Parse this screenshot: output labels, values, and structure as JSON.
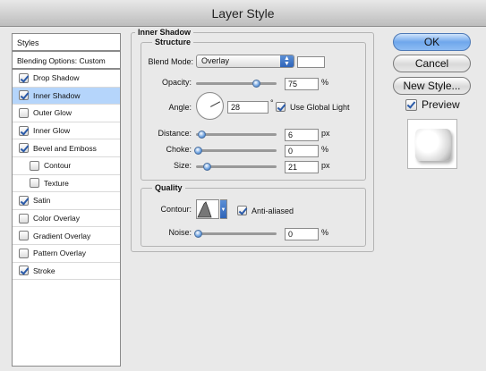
{
  "window": {
    "title": "Layer Style"
  },
  "styles_panel": {
    "header": "Styles",
    "blending_options": "Blending Options: Custom",
    "items": [
      {
        "label": "Drop Shadow",
        "checked": true,
        "selected": false,
        "sub": false
      },
      {
        "label": "Inner Shadow",
        "checked": true,
        "selected": true,
        "sub": false
      },
      {
        "label": "Outer Glow",
        "checked": false,
        "selected": false,
        "sub": false
      },
      {
        "label": "Inner Glow",
        "checked": true,
        "selected": false,
        "sub": false
      },
      {
        "label": "Bevel and Emboss",
        "checked": true,
        "selected": false,
        "sub": false
      },
      {
        "label": "Contour",
        "checked": false,
        "selected": false,
        "sub": true
      },
      {
        "label": "Texture",
        "checked": false,
        "selected": false,
        "sub": true
      },
      {
        "label": "Satin",
        "checked": true,
        "selected": false,
        "sub": false
      },
      {
        "label": "Color Overlay",
        "checked": false,
        "selected": false,
        "sub": false
      },
      {
        "label": "Gradient Overlay",
        "checked": false,
        "selected": false,
        "sub": false
      },
      {
        "label": "Pattern Overlay",
        "checked": false,
        "selected": false,
        "sub": false
      },
      {
        "label": "Stroke",
        "checked": true,
        "selected": false,
        "sub": false
      }
    ]
  },
  "inner_shadow": {
    "title": "Inner Shadow",
    "structure": {
      "title": "Structure",
      "blend_mode_label": "Blend Mode:",
      "blend_mode_value": "Overlay",
      "opacity_label": "Opacity:",
      "opacity_value": "75",
      "opacity_unit": "%",
      "opacity_level": 0.75,
      "angle_label": "Angle:",
      "angle_value": "28",
      "angle_unit": "°",
      "use_global_light_label": "Use Global Light",
      "use_global_light": true,
      "distance_label": "Distance:",
      "distance_value": "6",
      "distance_unit": "px",
      "choke_label": "Choke:",
      "choke_value": "0",
      "choke_unit": "%",
      "size_label": "Size:",
      "size_value": "21",
      "size_unit": "px"
    },
    "quality": {
      "title": "Quality",
      "contour_label": "Contour:",
      "anti_aliased_label": "Anti-aliased",
      "anti_aliased": true,
      "noise_label": "Noise:",
      "noise_value": "0",
      "noise_unit": "%"
    }
  },
  "buttons": {
    "ok": "OK",
    "cancel": "Cancel",
    "new_style": "New Style...",
    "preview_label": "Preview",
    "preview_checked": true
  },
  "icons": {
    "check": "checkmark-icon",
    "dropdown": "chevron-updown-icon",
    "angle": "angle-dial-icon"
  },
  "colors": {
    "selection": "#b5d5fb",
    "accent": "#2f64b8"
  }
}
